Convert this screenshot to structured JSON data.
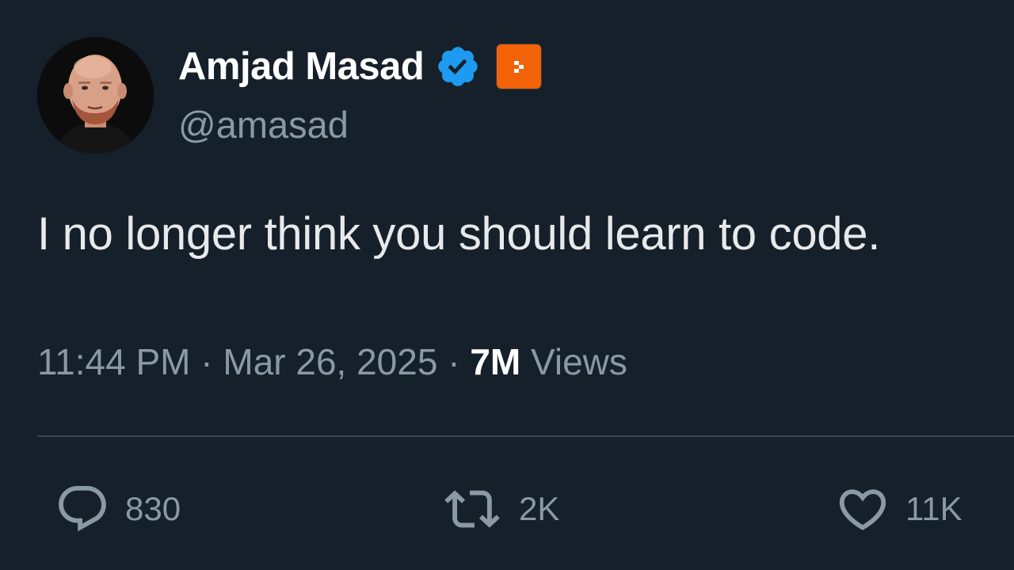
{
  "author": {
    "display_name": "Amjad Masad",
    "handle": "@amasad",
    "verified_icon": "verified-checkmark-icon",
    "affiliate_badge_icon": "replit-logo-icon",
    "colors": {
      "verified": "#1d9bf0",
      "affiliate_badge": "#f26207"
    }
  },
  "tweet": {
    "text": "I no longer think you should learn to code."
  },
  "meta": {
    "time": "11:44 PM",
    "separator": "·",
    "date": "Mar 26, 2025",
    "views_count": "7M",
    "views_label": "Views"
  },
  "actions": {
    "reply": {
      "icon": "reply-icon",
      "count": "830"
    },
    "retweet": {
      "icon": "retweet-icon",
      "count": "2K"
    },
    "like": {
      "icon": "heart-icon",
      "count": "11K"
    }
  },
  "theme": {
    "background": "#15202b",
    "text_primary": "#e7e9ea",
    "text_secondary": "#8b98a5",
    "divider": "#38444d"
  }
}
